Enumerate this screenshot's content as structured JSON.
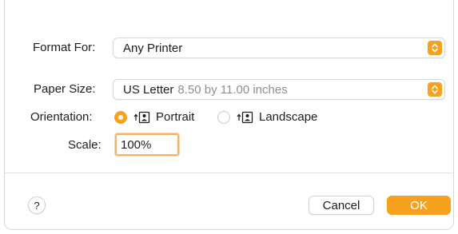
{
  "dialog": {
    "format_for": {
      "label": "Format For:",
      "value": "Any Printer"
    },
    "paper_size": {
      "label": "Paper Size:",
      "value": "US Letter",
      "detail": "8.50 by 11.00 inches"
    },
    "orientation": {
      "label": "Orientation:",
      "options": [
        {
          "label": "Portrait",
          "selected": true
        },
        {
          "label": "Landscape",
          "selected": false
        }
      ]
    },
    "scale": {
      "label": "Scale:",
      "value": "100%"
    },
    "help_label": "?",
    "cancel_label": "Cancel",
    "ok_label": "OK"
  },
  "icons": {
    "popup_stepper": "chevron-up-down-icon",
    "portrait": "portrait-orientation-icon",
    "landscape": "landscape-orientation-icon"
  },
  "colors": {
    "accent": "#f6a21e",
    "focus_ring": "#f5b26b",
    "secondary_text": "#8e8e93"
  }
}
